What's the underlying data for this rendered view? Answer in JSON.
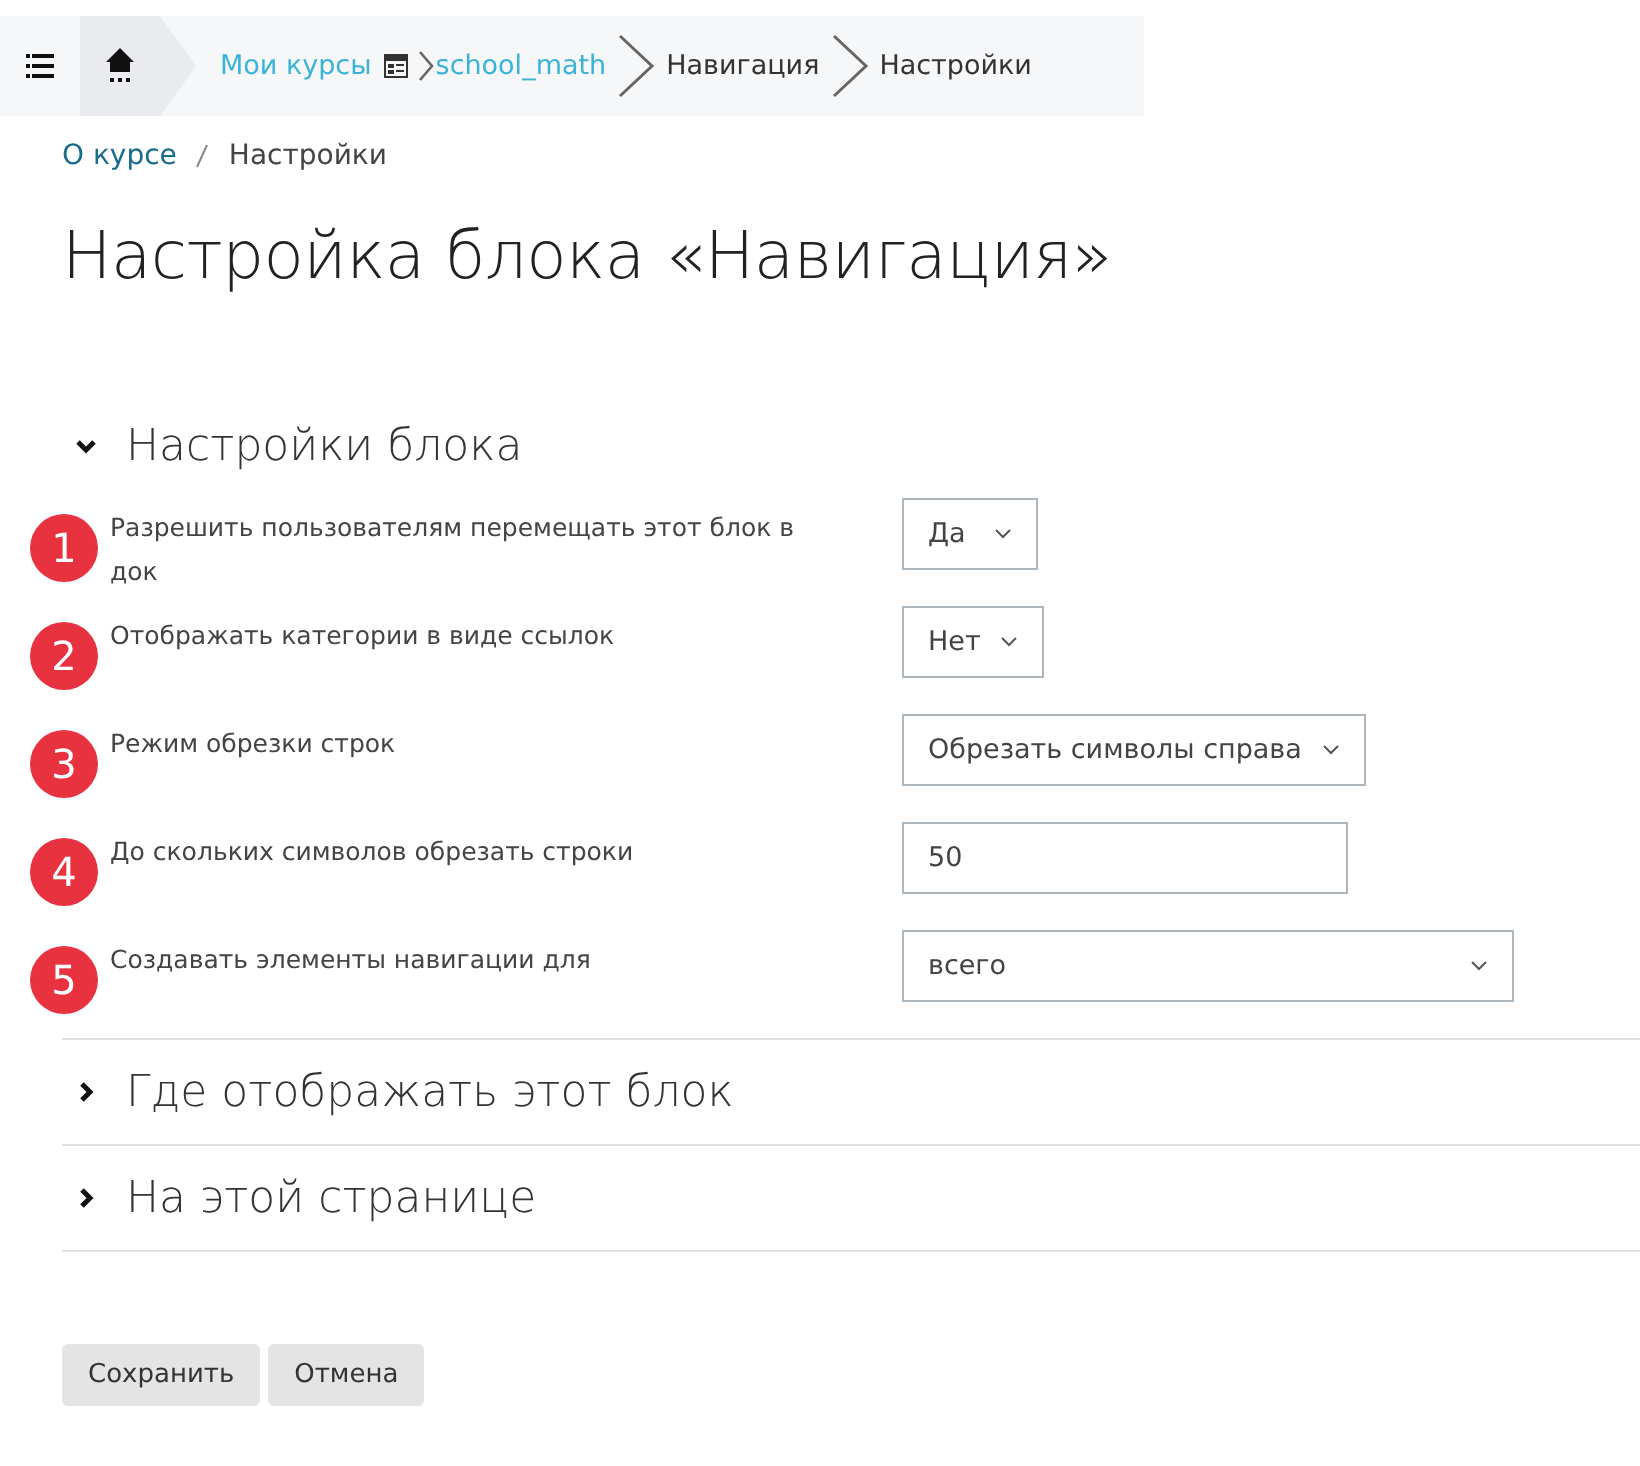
{
  "navbar": {
    "crumbs": [
      {
        "kind": "link",
        "label": "Мои курсы"
      },
      {
        "kind": "course",
        "label": "school_math"
      },
      {
        "kind": "plain",
        "label": "Навигация"
      },
      {
        "kind": "plain",
        "label": "Настройки"
      }
    ]
  },
  "breadcrumb": [
    {
      "label": "О курсе",
      "kind": "link"
    },
    {
      "label": "Настройки",
      "kind": "plain"
    }
  ],
  "title": "Настройка блока «Навигация»",
  "sections": [
    {
      "title": "Настройки блока",
      "expanded": true,
      "settings": [
        {
          "marker": "1",
          "label": "Разрешить пользователям перемещать этот блок в док",
          "kind": "select",
          "value": "Да"
        },
        {
          "marker": "2",
          "label": "Отображать категории в виде ссылок",
          "kind": "select",
          "value": "Нет"
        },
        {
          "marker": "3",
          "label": "Режим обрезки строк",
          "kind": "select",
          "value": "Обрезать символы справа"
        },
        {
          "marker": "4",
          "label": "До скольких символов обрезать строки",
          "kind": "text",
          "value": "50"
        },
        {
          "marker": "5",
          "label": "Создавать элементы навигации для",
          "kind": "wide_select",
          "value": "всего"
        }
      ]
    },
    {
      "title": "Где отображать этот блок",
      "expanded": false
    },
    {
      "title": "На этой странице",
      "expanded": false
    }
  ],
  "buttons": [
    "Сохранить",
    "Отмена"
  ]
}
